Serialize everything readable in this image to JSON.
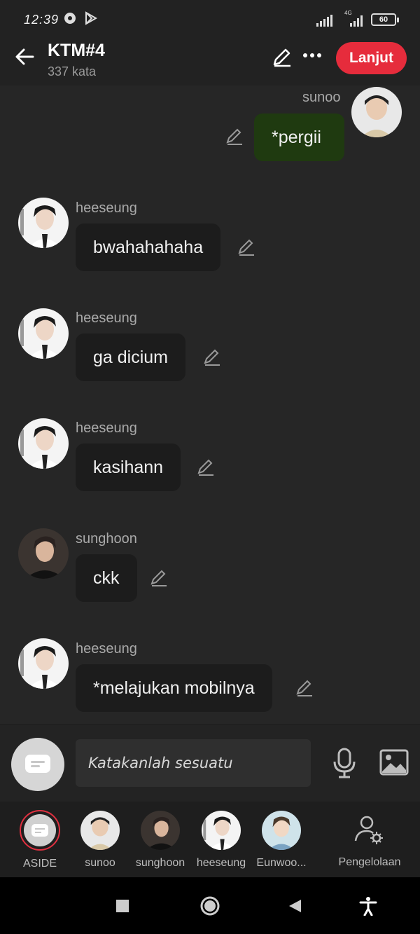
{
  "status_bar": {
    "time": "12:39",
    "network": "4G",
    "battery": "60"
  },
  "header": {
    "title": "KTM#4",
    "subtitle": "337 kata",
    "next_label": "Lanjut"
  },
  "messages": [
    {
      "sender": "sunoo",
      "text": "*pergii"
    },
    {
      "sender": "heeseung",
      "text": "bwahahahaha"
    },
    {
      "sender": "heeseung",
      "text": "ga dicium"
    },
    {
      "sender": "heeseung",
      "text": "kasihann"
    },
    {
      "sender": "sunghoon",
      "text": "ckk"
    },
    {
      "sender": "heeseung",
      "text": "*melajukan mobilnya"
    }
  ],
  "composer": {
    "placeholder": "Katakanlah sesuatu"
  },
  "characters": [
    {
      "label": "ASIDE"
    },
    {
      "label": "sunoo"
    },
    {
      "label": "sunghoon"
    },
    {
      "label": "heeseung"
    },
    {
      "label": "Eunwoo..."
    },
    {
      "label": "Pengelolaan"
    }
  ],
  "colors": {
    "accent": "#e62c3c",
    "own_bubble": "#1f3a10",
    "bubble": "#1c1c1c",
    "background": "#262626"
  }
}
